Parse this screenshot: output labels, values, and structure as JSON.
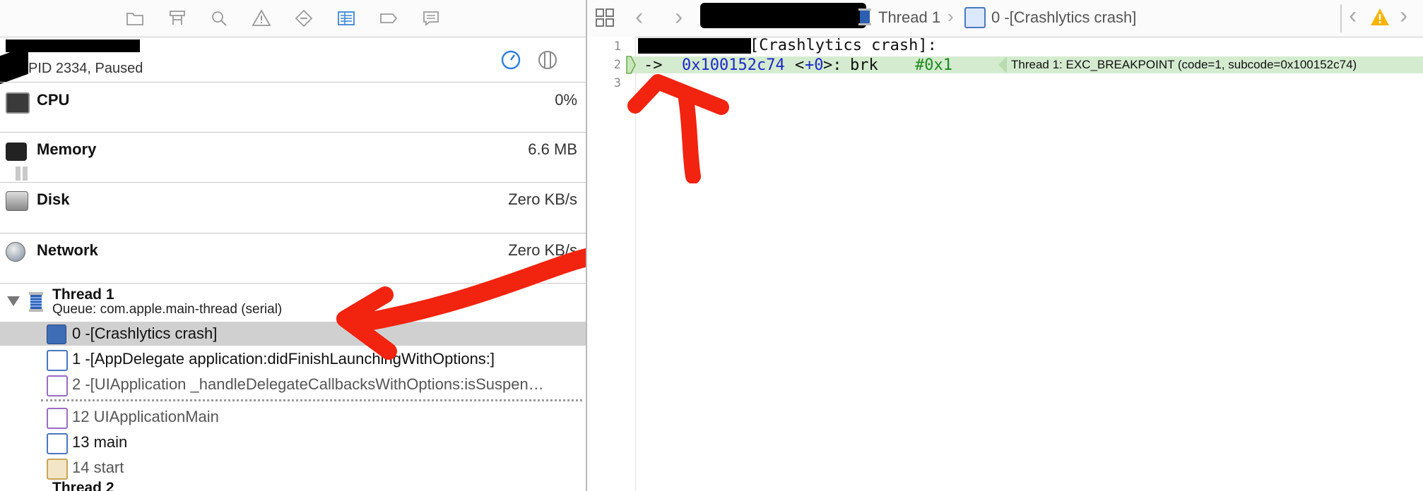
{
  "debug_navigator": {
    "process_status": "PID 2334, Paused",
    "gauges": [
      {
        "title": "CPU",
        "value": "0%"
      },
      {
        "title": "Memory",
        "value": "6.6 MB"
      },
      {
        "title": "Disk",
        "value": "Zero KB/s"
      },
      {
        "title": "Network",
        "value": "Zero KB/s"
      }
    ],
    "thread1": {
      "title": "Thread 1",
      "queue": "Queue: com.apple.main-thread (serial)",
      "frames": [
        {
          "label": "0 -[Crashlytics crash]",
          "kind": "user"
        },
        {
          "label": "1 -[AppDelegate application:didFinishLaunchingWithOptions:]",
          "kind": "user"
        },
        {
          "label": "2 -[UIApplication _handleDelegateCallbacksWithOptions:isSuspen…",
          "kind": "system"
        },
        {
          "label": "12 UIApplicationMain",
          "kind": "system"
        },
        {
          "label": "13 main",
          "kind": "user"
        },
        {
          "label": "14 start",
          "kind": "gear"
        }
      ]
    },
    "thread2": {
      "title": "Thread 2"
    }
  },
  "jump_bar": {
    "thread_label": "Thread 1",
    "frame_label": "0 -[Crashlytics crash]"
  },
  "editor": {
    "line_numbers": [
      "1",
      "2",
      "3"
    ],
    "line1_text": "[Crashlytics crash]:",
    "line2": {
      "pointer": "->",
      "address": "0x100152c74",
      "offset_open": "<",
      "offset_value": "+0",
      "offset_close": ">:",
      "mnemonic": "brk",
      "operand": "#0x1"
    },
    "exception": "Thread 1: EXC_BREAKPOINT (code=1, subcode=0x100152c74)"
  },
  "colors": {
    "highlight_row": "#d4ebd0",
    "selected_frame": "#d0d0d0",
    "annotation_red": "#f2230f",
    "address_blue": "#1e27c9",
    "operand_green": "#1c8a1c"
  },
  "icons": [
    "folder-icon",
    "symbol-icon",
    "search-icon",
    "warning-icon",
    "test-icon",
    "debug-icon",
    "breakpoint-icon",
    "report-icon",
    "grid-icon",
    "back-icon",
    "forward-icon",
    "thread-icon",
    "gauge-icon",
    "split-icon"
  ]
}
